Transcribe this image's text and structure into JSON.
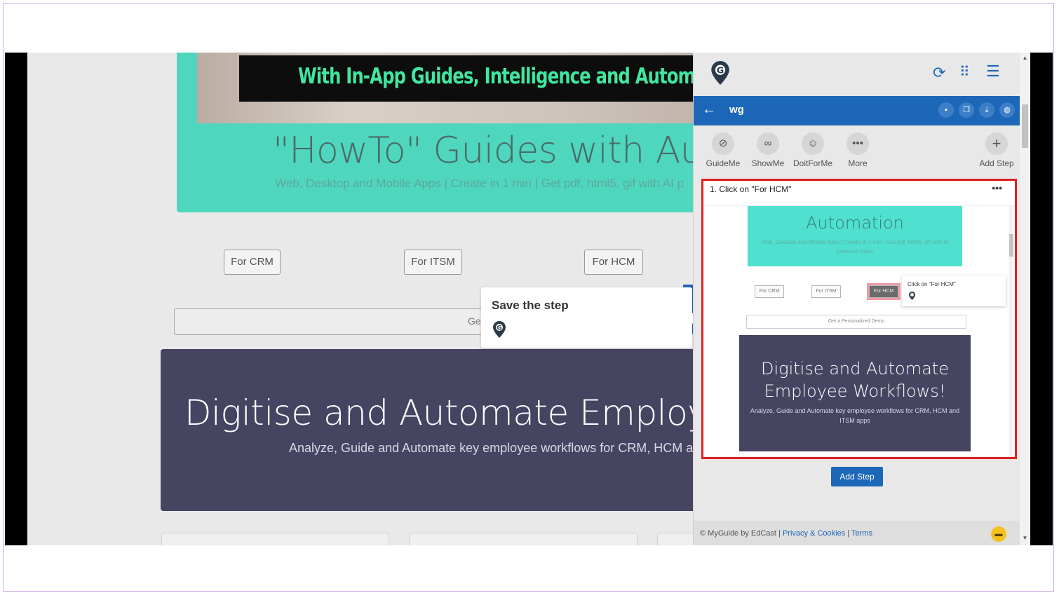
{
  "page": {
    "hero_banner": "With In-App Guides, Intelligence and Automati",
    "hero_title": "\"HowTo\" Guides with Autom",
    "hero_subtitle": "Web, Desktop and Mobile Apps | Create in 1 min | Get pdf, html5, gif with AI p",
    "buttons": [
      "For CRM",
      "For ITSM",
      "For HCM"
    ],
    "demo_input_text": "Ge",
    "purple_title": "Digitise and Automate Employee",
    "purple_subtitle": "Analyze, Guide and Automate key employee workflows for CRM, HCM and"
  },
  "tooltip": {
    "title": "Save the step"
  },
  "panel": {
    "guide_name": "wg",
    "tools": [
      {
        "label": "GuideMe",
        "icon": "compass-icon"
      },
      {
        "label": "ShowMe",
        "icon": "binoculars-icon"
      },
      {
        "label": "DoitForMe",
        "icon": "robot-icon"
      },
      {
        "label": "More",
        "icon": "more-dots-icon"
      },
      {
        "label": "Add Step",
        "icon": "plus-icon"
      }
    ],
    "step": {
      "title": "1. Click on \"For HCM\"",
      "preview": {
        "hero_title": "Automation",
        "hero_sub": "Web, Desktop and Mobile Apps | Create in 1 min | Get pdf, html5, gif with AI powered video",
        "buttons": [
          "For CRM",
          "For ITSM",
          "For HCM"
        ],
        "tip": "Click on \"For HCM\"",
        "demo": "Get a Personalized Demo",
        "purple_title": "Digitise and Automate Employee Workflows!",
        "purple_sub": "Analyze, Guide and Automate key employee workflows for CRM, HCM and ITSM apps"
      }
    },
    "add_step_button": "Add Step",
    "footer": {
      "copyright": "© MyGuide by EdCast",
      "privacy": "Privacy & Cookies",
      "terms": "Terms"
    }
  },
  "colors": {
    "accent_blue": "#1c67b8",
    "teal": "#4fd6bf",
    "purple": "#454562",
    "highlight_red": "#e02020"
  }
}
